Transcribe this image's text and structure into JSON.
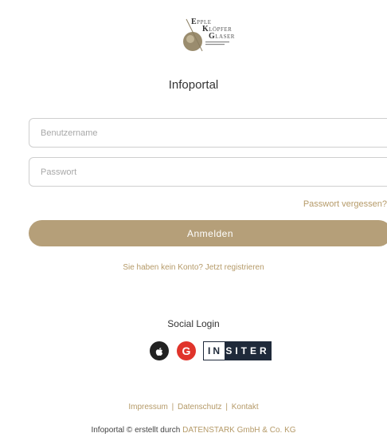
{
  "logo": {
    "line1_cap": "E",
    "line1_rest": "PPLE",
    "line2_cap": "K",
    "line2_rest": "LÖPFER",
    "line3_cap": "G",
    "line3_rest": "LASER"
  },
  "page": {
    "title": "Infoportal"
  },
  "login": {
    "username_placeholder": "Benutzername",
    "password_placeholder": "Passwort",
    "forgot_label": "Passwort vergessen?",
    "submit_label": "Anmelden",
    "register_label": "Sie haben kein Konto? Jetzt registrieren"
  },
  "social": {
    "title": "Social Login",
    "google_letter": "G",
    "insiter_in": "IN",
    "insiter_rest": "SITER"
  },
  "footer": {
    "impressum": "Impressum",
    "datenschutz": "Datenschutz",
    "kontakt": "Kontakt",
    "separator": "|",
    "credit_prefix": "Infoportal © erstellt durch ",
    "credit_link": "DATENSTARK GmbH & Co. KG"
  },
  "colors": {
    "accent": "#b59a68",
    "button": "#b59f79",
    "google": "#e0342b",
    "insiter": "#1f2a3a"
  }
}
